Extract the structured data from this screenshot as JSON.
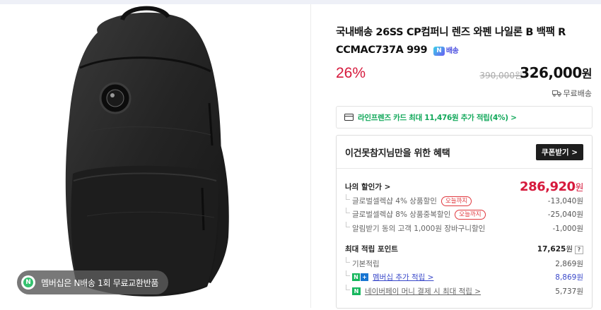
{
  "product": {
    "title": "국내배송 26SS CP컴퍼니 렌즈 와펜 나일론 B 백팩 R CCMAC737A 999",
    "delivery_badge": "N",
    "delivery_badge_label": "배송",
    "membership_pill": "멤버십은 N배송 1회 무료교환반품"
  },
  "price": {
    "discount_rate": "26%",
    "original": "390,000원",
    "sale": "326,000",
    "sale_unit": "원",
    "shipping": "무료배송"
  },
  "card_promo": "라인프렌즈 카드 최대 11,476원 추가 적립(4%) >",
  "benefit": {
    "heading": "이건못참지님만을 위한 혜택",
    "coupon_button": "쿠폰받기 >",
    "my_discount_label": "나의 할인가 >",
    "my_discount_value": "286,920",
    "my_discount_unit": "원",
    "discounts": [
      {
        "label": "글로벌셀렉샵 4% 상품할인",
        "badge": "오늘까지",
        "value": "-13,040원"
      },
      {
        "label": "글로벌셀렉샵 8% 상품중복할인",
        "badge": "오늘까지",
        "value": "-25,040원"
      },
      {
        "label": "알림받기 동의 고객 1,000원 장바구니할인",
        "badge": "",
        "value": "-1,000원"
      }
    ],
    "points_label": "최대 적립 포인트",
    "points_value": "17,625",
    "points_unit": "원",
    "points_help": "?",
    "points": [
      {
        "label": "기본적립",
        "value": "2,869원"
      },
      {
        "label": "멤버십 추가 적립 >",
        "value": "8,869원"
      },
      {
        "label": "네이버페이 머니 결제 시 최대 적립 >",
        "value": "5,737원"
      }
    ],
    "membership_tag_n": "N",
    "membership_tag_plus": "+",
    "pay_tag": "N"
  },
  "colors": {
    "discount_red": "#d6193c",
    "card_green": "#11a85a",
    "link_blue": "#3a49c9"
  },
  "icons": [
    "card-icon",
    "truck-icon",
    "n-delivery-icon",
    "n-membership-icon",
    "npay-icon"
  ]
}
